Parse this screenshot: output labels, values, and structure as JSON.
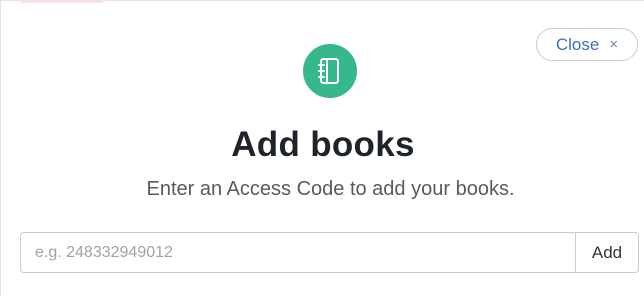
{
  "dialog": {
    "close_label": "Close",
    "close_icon": "×",
    "icon": "notebook-icon",
    "title": "Add books",
    "subtitle": "Enter an Access Code to add your books."
  },
  "access_code": {
    "value": "",
    "placeholder": "e.g. 248332949012",
    "submit_label": "Add"
  },
  "colors": {
    "accent": "#35b88a",
    "link": "#3f70b8",
    "title": "#1e2429"
  }
}
